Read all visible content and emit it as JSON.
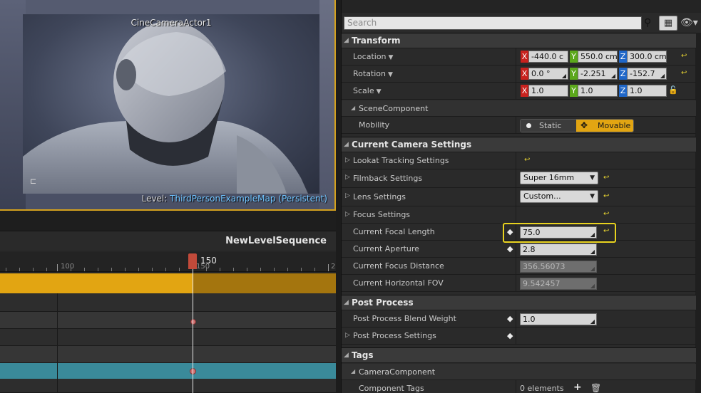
{
  "viewport": {
    "camera_name": "CineCameraActor1",
    "level_label": "Level:",
    "level_value": "ThirdPersonExampleMap (Persistent)",
    "bracket_glyph": "⊏"
  },
  "sequencer": {
    "title": "NewLevelSequence",
    "ruler_labels": [
      "100",
      "150",
      "2"
    ],
    "playhead_frame": "150"
  },
  "details": {
    "search_placeholder": "Search",
    "transform": {
      "header": "Transform",
      "location_label": "Location",
      "location": {
        "x": "-440.0 c",
        "y": "550.0 cm",
        "z": "300.0 cm"
      },
      "rotation_label": "Rotation",
      "rotation": {
        "x": "0.0 °",
        "y": "-2.251",
        "z": "-152.7"
      },
      "scale_label": "Scale",
      "scale": {
        "x": "1.0",
        "y": "1.0",
        "z": "1.0"
      }
    },
    "scene_component": {
      "header": "SceneComponent",
      "mobility_label": "Mobility",
      "static_label": "Static",
      "movable_label": "Movable"
    },
    "camera_settings": {
      "header": "Current Camera Settings",
      "lookat": "Lookat Tracking Settings",
      "filmback": "Filmback Settings",
      "filmback_value": "Super 16mm",
      "lens": "Lens Settings",
      "lens_value": "Custom...",
      "focus": "Focus Settings",
      "focal_length_label": "Current Focal Length",
      "focal_length": "75.0",
      "aperture_label": "Current Aperture",
      "aperture": "2.8",
      "focus_distance_label": "Current Focus Distance",
      "focus_distance": "356.56073",
      "hfov_label": "Current Horizontal FOV",
      "hfov": "9.542457"
    },
    "post_process": {
      "header": "Post Process",
      "blend_weight_label": "Post Process Blend Weight",
      "blend_weight": "1.0",
      "settings_label": "Post Process Settings"
    },
    "tags": {
      "header": "Tags",
      "camera_component": "CameraComponent",
      "component_tags_label": "Component Tags",
      "component_tags_value": "0 elements"
    },
    "axes": {
      "x": "X",
      "y": "Y",
      "z": "Z"
    }
  },
  "colors": {
    "accent": "#e2a512",
    "axis_x": "#c8221e",
    "axis_y": "#5ca81c",
    "axis_z": "#2067c8",
    "teal_track": "#3a8a9a",
    "highlight": "#e8d21e"
  }
}
